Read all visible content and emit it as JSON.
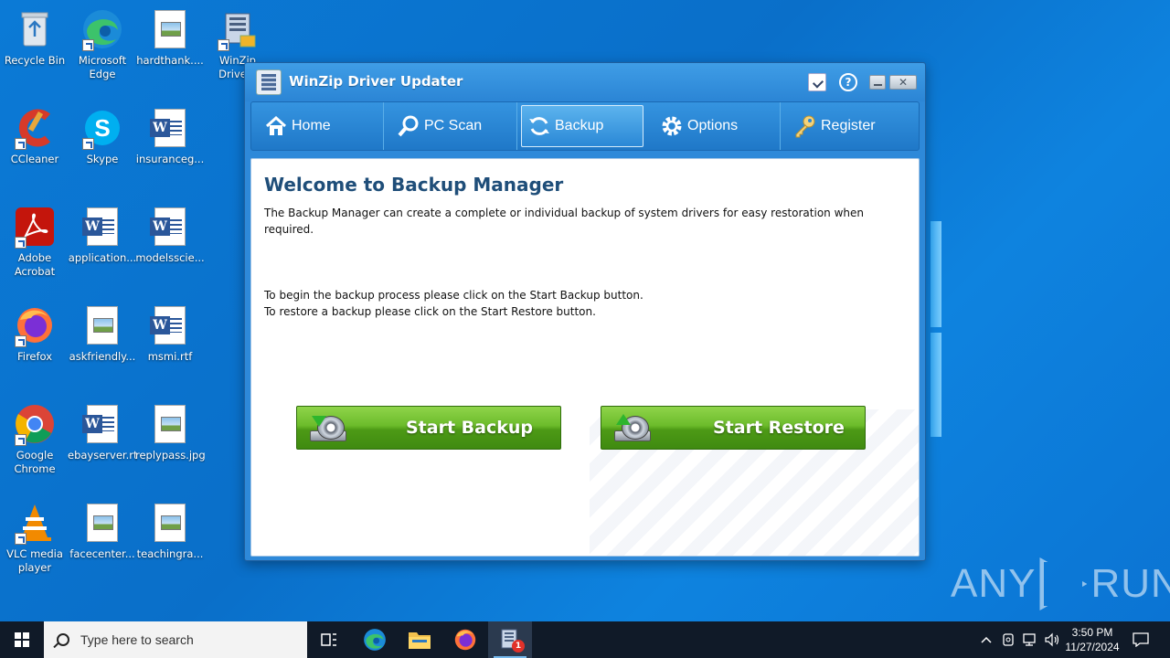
{
  "desktop": {
    "icons": [
      {
        "label": "Recycle Bin",
        "icon": "recycle-bin-icon"
      },
      {
        "label": "Microsoft Edge",
        "icon": "edge-icon"
      },
      {
        "label": "hardthank....",
        "icon": "image-file-icon"
      },
      {
        "label": "WinZip Drive...",
        "icon": "winzip-driver-updater-icon"
      },
      {
        "label": "CCleaner",
        "icon": "ccleaner-icon"
      },
      {
        "label": "Skype",
        "icon": "skype-icon"
      },
      {
        "label": "insuranceg...",
        "icon": "word-file-icon"
      },
      {
        "label": "Adobe Acrobat",
        "icon": "acrobat-icon"
      },
      {
        "label": "application...",
        "icon": "word-file-icon"
      },
      {
        "label": "modelsscie...",
        "icon": "word-file-icon"
      },
      {
        "label": "Firefox",
        "icon": "firefox-icon"
      },
      {
        "label": "askfriendly...",
        "icon": "image-file-icon"
      },
      {
        "label": "msmi.rtf",
        "icon": "word-file-icon"
      },
      {
        "label": "Google Chrome",
        "icon": "chrome-icon"
      },
      {
        "label": "ebayserver.rtf",
        "icon": "word-file-icon"
      },
      {
        "label": "replypass.jpg",
        "icon": "image-file-icon"
      },
      {
        "label": "VLC media player",
        "icon": "vlc-icon"
      },
      {
        "label": "facecenter...",
        "icon": "image-file-icon"
      },
      {
        "label": "teachingra...",
        "icon": "image-file-icon"
      }
    ]
  },
  "app": {
    "title": "WinZip Driver Updater",
    "help_glyph": "?",
    "close_glyph": "✕",
    "tabs": [
      {
        "label": "Home",
        "icon": "home-icon"
      },
      {
        "label": "PC Scan",
        "icon": "magnifier-icon"
      },
      {
        "label": "Backup",
        "icon": "refresh-icon",
        "active": true
      },
      {
        "label": "Options",
        "icon": "gear-icon"
      },
      {
        "label": "Register",
        "icon": "key-icon"
      }
    ],
    "content": {
      "heading": "Welcome to Backup Manager",
      "intro": "The Backup Manager can create a complete or individual backup of system drivers for easy restoration when required.",
      "instruction_backup": "To begin the backup process please click on the Start Backup button.",
      "instruction_restore": "To restore a backup please click on the Start Restore button.",
      "start_backup_label": "Start Backup",
      "start_restore_label": "Start Restore"
    }
  },
  "taskbar": {
    "search_placeholder": "Type here to search",
    "apps": [
      "task-view",
      "edge",
      "file-explorer",
      "firefox",
      "winzip-driver-updater"
    ],
    "badge": "1",
    "time": "3:50 PM",
    "date": "11/27/2024"
  },
  "watermark": {
    "left": "ANY",
    "right": "RUN"
  },
  "colors": {
    "accent_blue": "#2e89d9",
    "heading_blue": "#1f4e79",
    "button_green": "#5aa91e",
    "taskbar": "#101a28"
  }
}
